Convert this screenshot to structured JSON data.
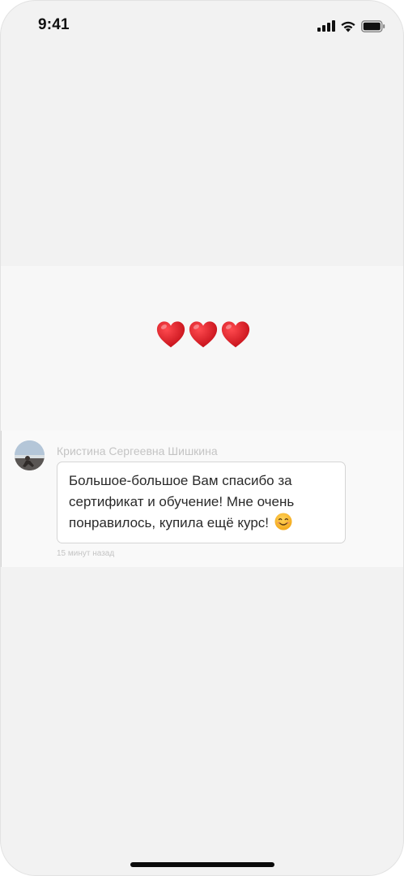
{
  "status_bar": {
    "time": "9:41",
    "icons": [
      "signal-icon",
      "wifi-icon",
      "battery-icon"
    ]
  },
  "reaction": {
    "hearts": [
      "❤️",
      "❤️",
      "❤️"
    ],
    "heart_color": "#e0161f"
  },
  "comment": {
    "author": "Кристина Сергеевна Шишкина",
    "text": "Большое-большое Вам спасибо за сертификат и обучение! Мне очень понравилось, купила ещё курс!",
    "emoji": "smiling-face-icon",
    "time_ago": "15 минут назад"
  }
}
